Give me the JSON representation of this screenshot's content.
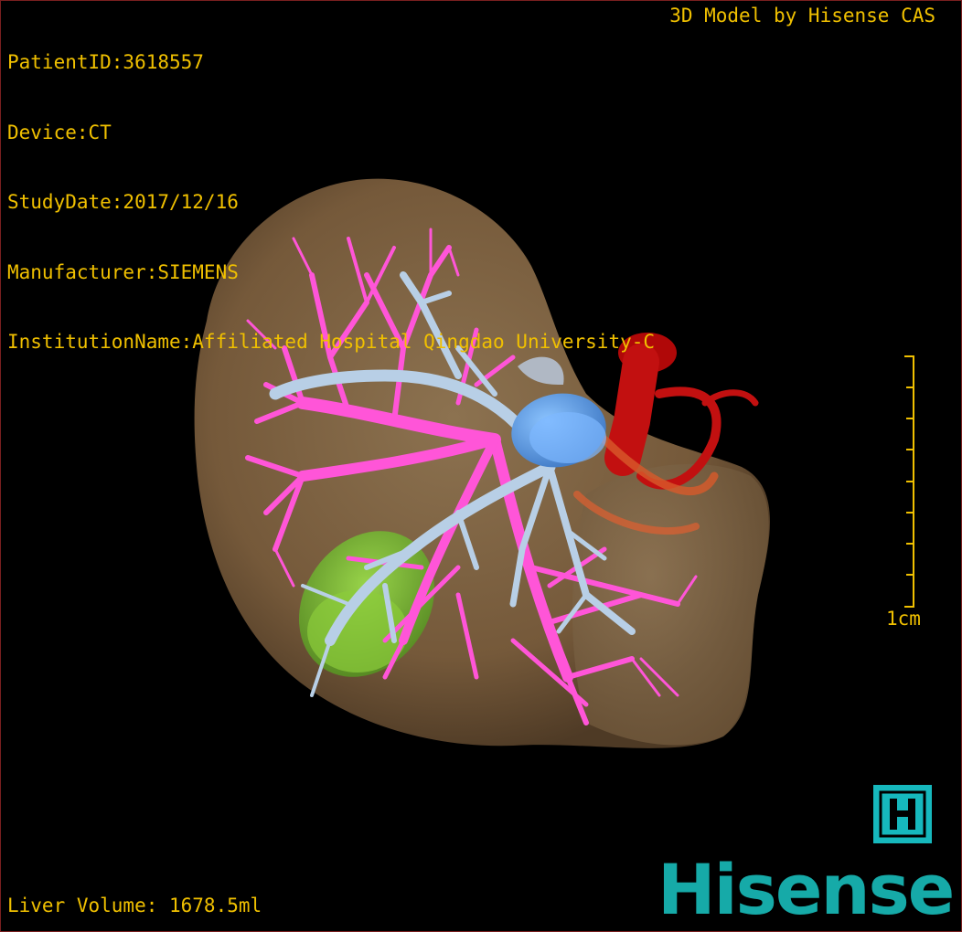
{
  "info": {
    "patient_id": "PatientID:3618557",
    "device": "Device:CT",
    "study_date": "StudyDate:2017/12/16",
    "manufacturer": "Manufacturer:SIEMENS",
    "institution": "InstitutionName:Affiliated Hospital Qingdao University-C"
  },
  "credit": "3D Model by Hisense CAS",
  "volume": "Liver Volume: 1678.5ml",
  "scale_bar": {
    "label": "1cm"
  },
  "brand": {
    "logo_letter": "H",
    "wordmark": "Hisense",
    "color": "#16aaa8"
  },
  "colors": {
    "overlay_text": "#f0c000",
    "liver": "#7a6040",
    "hepatic_vein": "#ff55d8",
    "portal_vein": "#b8cfe6",
    "vena_cava": "#6aa8ea",
    "aorta": "#c21010",
    "gallbladder": "#7cc43a"
  }
}
